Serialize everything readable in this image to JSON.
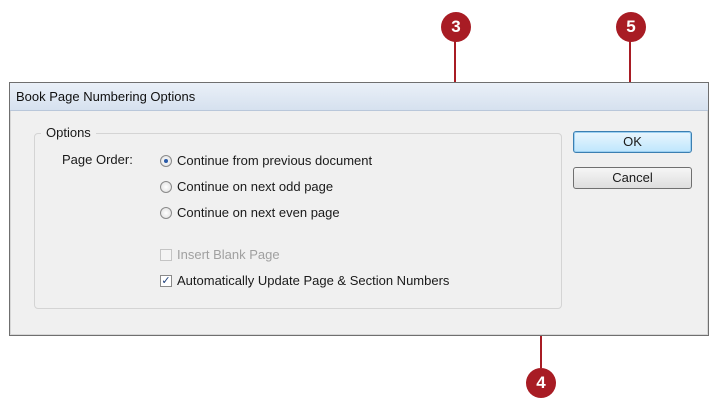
{
  "dialog": {
    "title": "Book Page Numbering Options",
    "group_label": "Options",
    "page_order_label": "Page Order:",
    "radios": [
      {
        "label": "Continue from previous document",
        "selected": true
      },
      {
        "label": "Continue on next odd page",
        "selected": false
      },
      {
        "label": "Continue on next even page",
        "selected": false
      }
    ],
    "checkboxes": [
      {
        "label": "Insert Blank Page",
        "checked": false,
        "enabled": false
      },
      {
        "label": "Automatically Update Page & Section Numbers",
        "checked": true,
        "enabled": true
      }
    ],
    "ok_label": "OK",
    "cancel_label": "Cancel"
  },
  "callouts": [
    "3",
    "5",
    "4"
  ],
  "colors": {
    "callout": "#a81c24"
  }
}
